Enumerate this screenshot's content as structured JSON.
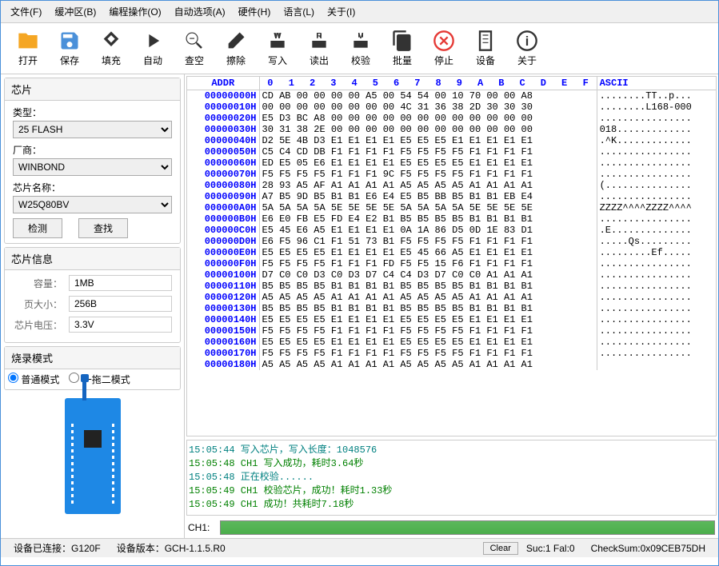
{
  "menu": [
    "文件(F)",
    "缓冲区(B)",
    "编程操作(O)",
    "自动选项(A)",
    "硬件(H)",
    "语言(L)",
    "关于(I)"
  ],
  "toolbar": [
    {
      "label": "打开",
      "icon": "open"
    },
    {
      "label": "保存",
      "icon": "save"
    },
    {
      "label": "填充",
      "icon": "fill"
    },
    {
      "label": "自动",
      "icon": "auto"
    },
    {
      "label": "查空",
      "icon": "blank"
    },
    {
      "label": "擦除",
      "icon": "erase"
    },
    {
      "label": "写入",
      "icon": "write"
    },
    {
      "label": "读出",
      "icon": "read"
    },
    {
      "label": "校验",
      "icon": "verify"
    },
    {
      "label": "批量",
      "icon": "batch"
    },
    {
      "label": "停止",
      "icon": "stop"
    },
    {
      "label": "设备",
      "icon": "device"
    },
    {
      "label": "关于",
      "icon": "about"
    }
  ],
  "chip_panel": {
    "title": "芯片",
    "type_label": "类型：",
    "type_value": "25 FLASH",
    "vendor_label": "厂商：",
    "vendor_value": "WINBOND",
    "name_label": "芯片名称：",
    "name_value": "W25Q80BV",
    "detect_btn": "检测",
    "find_btn": "查找"
  },
  "info_panel": {
    "title": "芯片信息",
    "capacity_label": "容量：",
    "capacity_value": "1MB",
    "page_label": "页大小：",
    "page_value": "256B",
    "voltage_label": "芯片电压：",
    "voltage_value": "3.3V"
  },
  "mode_panel": {
    "title": "烧录模式",
    "normal": "普通模式",
    "dual": "一拖二模式"
  },
  "hex": {
    "addr_header": "ADDR",
    "cols": [
      "0",
      "1",
      "2",
      "3",
      "4",
      "5",
      "6",
      "7",
      "8",
      "9",
      "A",
      "B",
      "C",
      "D",
      "E",
      "F"
    ],
    "ascii_header": "ASCII",
    "rows": [
      {
        "addr": "00000000H",
        "bytes": "CD AB 00 00 00 00 A5 00 54 54 00 10 70 00 00 A8",
        "ascii": "........TT..p..."
      },
      {
        "addr": "00000010H",
        "bytes": "00 00 00 00 00 00 00 00 4C 31 36 38 2D 30 30 30",
        "ascii": "........L168-000"
      },
      {
        "addr": "00000020H",
        "bytes": "E5 D3 BC A8 00 00 00 00 00 00 00 00 00 00 00 00",
        "ascii": "................"
      },
      {
        "addr": "00000030H",
        "bytes": "30 31 38 2E 00 00 00 00 00 00 00 00 00 00 00 00",
        "ascii": "018............."
      },
      {
        "addr": "00000040H",
        "bytes": "D2 5E 4B D3 E1 E1 E1 E1 E5 E5 E5 E1 E1 E1 E1 E1",
        "ascii": ".^K............."
      },
      {
        "addr": "00000050H",
        "bytes": "C5 C4 CD DB F1 F1 F1 F1 F5 F5 F5 F5 F1 F1 F1 F1",
        "ascii": "................"
      },
      {
        "addr": "00000060H",
        "bytes": "ED E5 05 E6 E1 E1 E1 E1 E5 E5 E5 E5 E1 E1 E1 E1",
        "ascii": "................"
      },
      {
        "addr": "00000070H",
        "bytes": "F5 F5 F5 F5 F1 F1 F1 9C F5 F5 F5 F5 F1 F1 F1 F1",
        "ascii": "................"
      },
      {
        "addr": "00000080H",
        "bytes": "28 93 A5 AF A1 A1 A1 A1 A5 A5 A5 A5 A1 A1 A1 A1",
        "ascii": "(..............."
      },
      {
        "addr": "00000090H",
        "bytes": "A7 B5 9D B5 B1 B1 E6 E4 E5 B5 BB B5 B1 B1 EB E4",
        "ascii": "................"
      },
      {
        "addr": "000000A0H",
        "bytes": "5A 5A 5A 5A 5E 5E 5E 5E 5A 5A 5A 5A 5E 5E 5E 5E",
        "ascii": "ZZZZ^^^^ZZZZ^^^^"
      },
      {
        "addr": "000000B0H",
        "bytes": "E6 E0 FB E5 FD E4 E2 B1 B5 B5 B5 B5 B1 B1 B1 B1",
        "ascii": "................"
      },
      {
        "addr": "000000C0H",
        "bytes": "E5 45 E6 A5 E1 E1 E1 E1 0A 1A 86 D5 0D 1E 83 D1",
        "ascii": ".E.............."
      },
      {
        "addr": "000000D0H",
        "bytes": "E6 F5 96 C1 F1 51 73 B1 F5 F5 F5 F5 F1 F1 F1 F1",
        "ascii": ".....Qs........."
      },
      {
        "addr": "000000E0H",
        "bytes": "E5 E5 E5 E5 E1 E1 E1 E1 E5 45 66 A5 E1 E1 E1 E1",
        "ascii": ".........Ef....."
      },
      {
        "addr": "000000F0H",
        "bytes": "F5 F5 F5 F5 F1 F1 F1 FD F5 F5 15 F6 F1 F1 F1 F1",
        "ascii": "................"
      },
      {
        "addr": "00000100H",
        "bytes": "D7 C0 C0 D3 C0 D3 D7 C4 C4 D3 D7 C0 C0 A1 A1 A1",
        "ascii": "................"
      },
      {
        "addr": "00000110H",
        "bytes": "B5 B5 B5 B5 B1 B1 B1 B1 B5 B5 B5 B5 B1 B1 B1 B1",
        "ascii": "................"
      },
      {
        "addr": "00000120H",
        "bytes": "A5 A5 A5 A5 A1 A1 A1 A1 A5 A5 A5 A5 A1 A1 A1 A1",
        "ascii": "................"
      },
      {
        "addr": "00000130H",
        "bytes": "B5 B5 B5 B5 B1 B1 B1 B1 B5 B5 B5 B5 B1 B1 B1 B1",
        "ascii": "................"
      },
      {
        "addr": "00000140H",
        "bytes": "E5 E5 E5 E5 E1 E1 E1 E1 E5 E5 E5 E5 E1 E1 E1 E1",
        "ascii": "................"
      },
      {
        "addr": "00000150H",
        "bytes": "F5 F5 F5 F5 F1 F1 F1 F1 F5 F5 F5 F5 F1 F1 F1 F1",
        "ascii": "................"
      },
      {
        "addr": "00000160H",
        "bytes": "E5 E5 E5 E5 E1 E1 E1 E1 E5 E5 E5 E5 E1 E1 E1 E1",
        "ascii": "................"
      },
      {
        "addr": "00000170H",
        "bytes": "F5 F5 F5 F5 F1 F1 F1 F1 F5 F5 F5 F5 F1 F1 F1 F1",
        "ascii": "................"
      },
      {
        "addr": "00000180H",
        "bytes": "A5 A5 A5 A5 A1 A1 A1 A1 A5 A5 A5 A5 A1 A1 A1 A1",
        "ascii": ""
      }
    ]
  },
  "log": [
    {
      "cls": "log-line1",
      "text": "15:05:44 写入芯片，写入长度：1048576"
    },
    {
      "cls": "log-line2",
      "text": "15:05:48 CH1 写入成功，耗时3.64秒"
    },
    {
      "cls": "log-line1",
      "text": "15:05:48 正在校验......"
    },
    {
      "cls": "log-line2",
      "text": "15:05:49 CH1 校验芯片，成功！耗时1.33秒"
    },
    {
      "cls": "log-line2",
      "text": "15:05:49 CH1 成功！共耗时7.18秒"
    }
  ],
  "progress": {
    "label": "CH1:"
  },
  "status": {
    "connected": "设备已连接：G120F",
    "version": "设备版本：GCH-1.1.5.R0",
    "clear": "Clear",
    "sucfail": "Suc:1  Fal:0",
    "checksum": "CheckSum:0x09CEB75DH"
  }
}
